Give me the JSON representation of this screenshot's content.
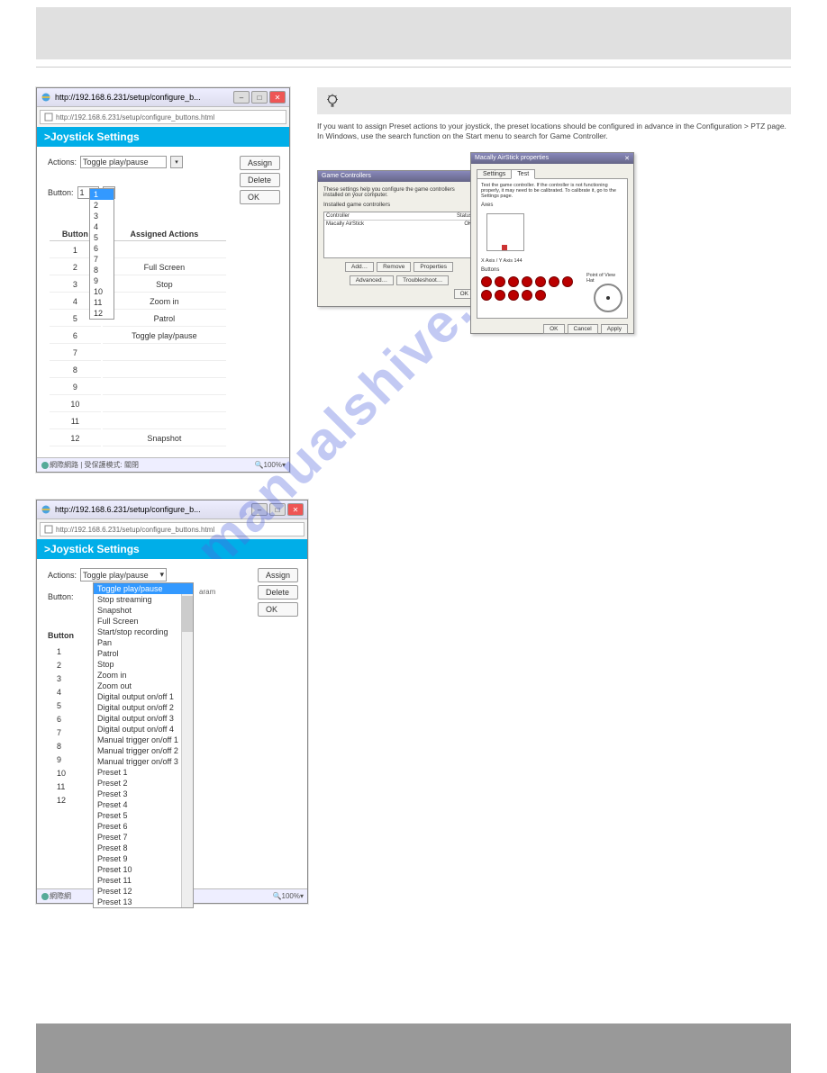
{
  "watermark": "manualshive.com",
  "popup1": {
    "titlebar": "http://192.168.6.231/setup/configure_b...",
    "url": "http://192.168.6.231/setup/configure_buttons.html",
    "banner": ">Joystick Settings",
    "actions_label": "Actions:",
    "actions_value": "Toggle play/pause",
    "button_label": "Button:",
    "button_value": "1",
    "btn_assign": "Assign",
    "btn_delete": "Delete",
    "btn_ok": "OK",
    "th_button": "Button",
    "th_actions": "Assigned Actions",
    "rows": [
      {
        "n": "1",
        "a": ""
      },
      {
        "n": "2",
        "a": "Full Screen"
      },
      {
        "n": "3",
        "a": "Stop"
      },
      {
        "n": "4",
        "a": "Zoom in"
      },
      {
        "n": "5",
        "a": "Patrol"
      },
      {
        "n": "6",
        "a": "Toggle play/pause"
      },
      {
        "n": "7",
        "a": ""
      },
      {
        "n": "8",
        "a": ""
      },
      {
        "n": "9",
        "a": ""
      },
      {
        "n": "10",
        "a": ""
      },
      {
        "n": "11",
        "a": ""
      },
      {
        "n": "12",
        "a": "Snapshot"
      }
    ],
    "numlist": [
      "1",
      "2",
      "3",
      "4",
      "5",
      "6",
      "7",
      "8",
      "9",
      "10",
      "11",
      "12"
    ],
    "status_left": "網際網路 | 受保護模式: 關閉",
    "status_zoom": "100%"
  },
  "popup2": {
    "titlebar": "http://192.168.6.231/setup/configure_b...",
    "url": "http://192.168.6.231/setup/configure_buttons.html",
    "banner": ">Joystick Settings",
    "actions_label": "Actions:",
    "actions_value": "Toggle play/pause",
    "button_label": "Button:",
    "garam": "aram",
    "btn_assign": "Assign",
    "btn_delete": "Delete",
    "btn_ok": "OK",
    "th_button": "Button",
    "nums": [
      "1",
      "2",
      "3",
      "4",
      "5",
      "6",
      "7",
      "8",
      "9",
      "10",
      "11",
      "12"
    ],
    "options": [
      "Toggle play/pause",
      "Stop streaming",
      "Snapshot",
      "Full Screen",
      "Start/stop recording",
      "Pan",
      "Patrol",
      "Stop",
      "Zoom in",
      "Zoom out",
      "Digital output on/off 1",
      "Digital output on/off 2",
      "Digital output on/off 3",
      "Digital output on/off 4",
      "Manual trigger on/off 1",
      "Manual trigger on/off 2",
      "Manual trigger on/off 3",
      "Preset 1",
      "Preset 2",
      "Preset 3",
      "Preset 4",
      "Preset 5",
      "Preset 6",
      "Preset 7",
      "Preset 8",
      "Preset 9",
      "Preset 10",
      "Preset 11",
      "Preset 12",
      "Preset 13"
    ],
    "status_left": "網際網",
    "status_zoom": "100%"
  },
  "tip": {
    "text": "If you want to assign Preset actions to your joystick, the preset locations should be configured in advance in the Configuration > PTZ page. In Windows, use the search function on the Start menu to search for Game Controller."
  },
  "gc": {
    "title1": "Game Controllers",
    "desc": "These settings help you configure the game controllers installed on your computer.",
    "list_header": "Installed game controllers",
    "col1": "Controller",
    "col2": "Status",
    "row_name": "Macally AirStick",
    "row_status": "OK",
    "btn_add": "Add…",
    "btn_remove": "Remove",
    "btn_props": "Properties",
    "btn_adv": "Advanced…",
    "btn_trouble": "Troubleshoot…",
    "btn_ok": "OK",
    "btn_cancel": "Cancel",
    "btn_apply": "Apply",
    "title2": "Macally AirStick properties",
    "tab1": "Settings",
    "tab2": "Test",
    "test_text": "Test the game controller. If the controller is not functioning properly, it may need to be calibrated. To calibrate it, go to the Settings page.",
    "axis_label": "Axes",
    "axis_info": "X Axis / Y Axis  144",
    "buttons_label": "Buttons",
    "pov_label": "Point of View Hat"
  }
}
